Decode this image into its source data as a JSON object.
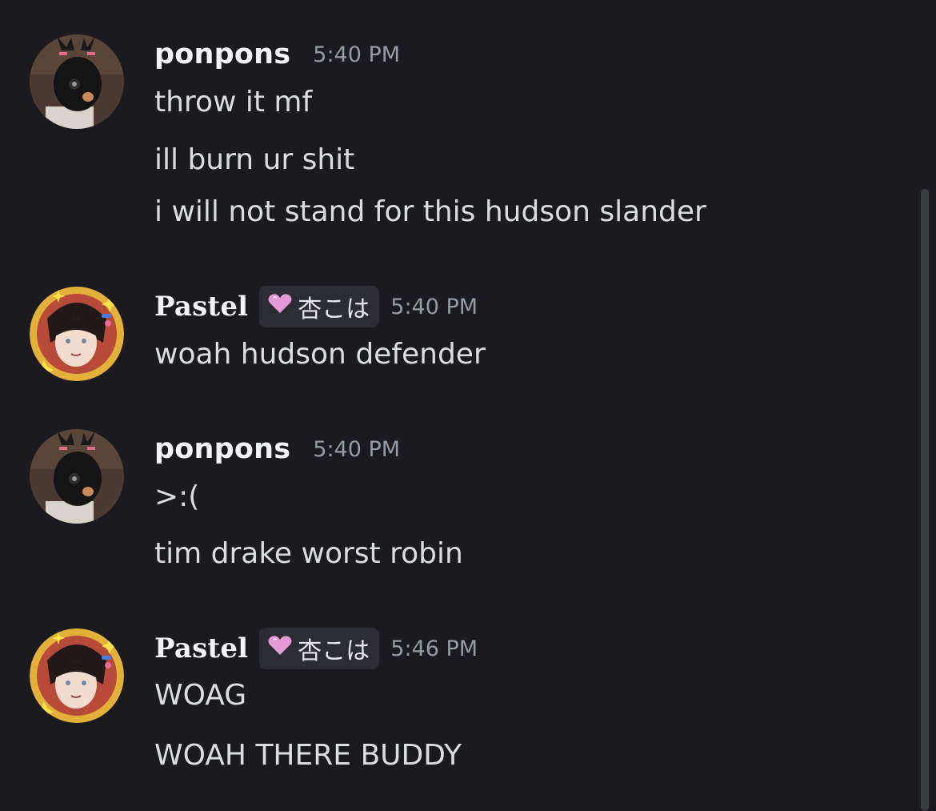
{
  "messages": [
    {
      "author": "ponpons",
      "timestamp": "5:40 PM",
      "lines": [
        "throw it mf",
        "ill burn ur shit",
        "i will not stand for this hudson slander"
      ],
      "avatar_icon": "masked-figure-avatar"
    },
    {
      "author": "Pastel",
      "tag": "杏こは",
      "tag_icon": "pink-heart-icon",
      "timestamp": "5:40 PM",
      "lines": [
        "woah hudson defender"
      ],
      "avatar_icon": "anime-character-avatar"
    },
    {
      "author": "ponpons",
      "timestamp": "5:40 PM",
      "lines": [
        ">:(",
        "tim drake worst robin"
      ],
      "avatar_icon": "masked-figure-avatar"
    },
    {
      "author": "Pastel",
      "tag": "杏こは",
      "tag_icon": "pink-heart-icon",
      "timestamp": "5:46 PM",
      "lines": [
        "WOAG",
        "WOAH THERE BUDDY"
      ],
      "avatar_icon": "anime-character-avatar"
    }
  ],
  "colors": {
    "background": "#1b1b1f",
    "username": "#f2f3f5",
    "timestamp": "#949ba4",
    "message_text": "#dbdee1",
    "tag_background": "#2b2d33",
    "heart": "#e59ad8"
  }
}
